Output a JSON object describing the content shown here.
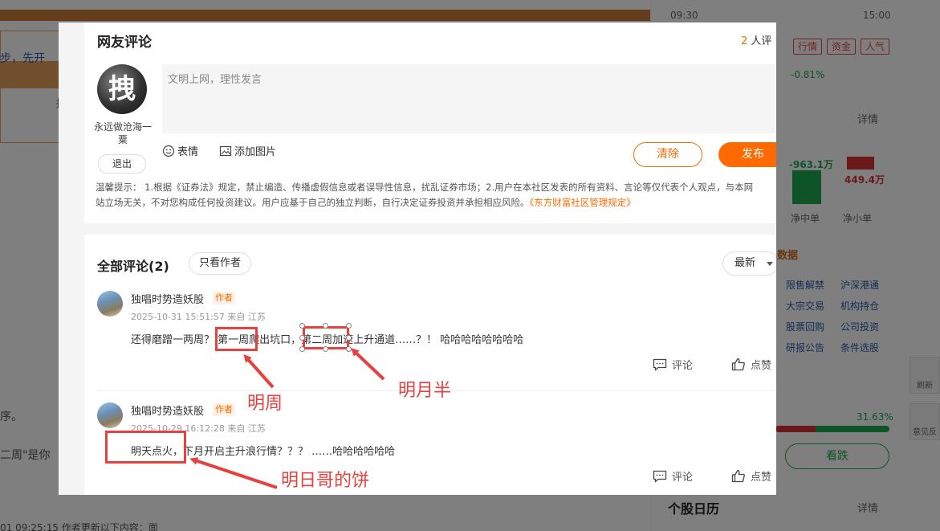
{
  "background": {
    "left_snippet_1": "步，先开",
    "left_snippet_2": "择",
    "left_snippet_3": "序。",
    "left_snippet_4": "二周\"是你",
    "left_footer": "01 09:25:15  作者更新以下内容：面",
    "time_start": "09:30",
    "time_end": "15:00",
    "tags": [
      "行情",
      "资金",
      "人气"
    ],
    "pct_change": "-0.81%",
    "detail_label": "详情",
    "fund_value_1": "-963.1万",
    "fund_value_2": "449.4万",
    "fund_label_1": "净中单",
    "fund_label_2": "净小单",
    "data_title": "数据",
    "links": [
      "限售解禁",
      "沪深港通",
      "大宗交易",
      "机构持仓",
      "股票回购",
      "公司投资",
      "研报公告",
      "条件选股"
    ],
    "ratio": "31.63%",
    "bear_button": "看跌",
    "tool_refresh": "刷新",
    "tool_feedback": "意见反",
    "calendar_title": "个股日历",
    "calendar_detail": "详情"
  },
  "modal": {
    "title": "网友评论",
    "count_num": "2",
    "count_text": "人评",
    "avatar_char": "拽",
    "username": "永远做沧海一粟",
    "logout": "退出",
    "editor_placeholder": "文明上网，理性发言",
    "tool_emoji": "表情",
    "tool_image": "添加图片",
    "btn_clear": "清除",
    "btn_post": "发布",
    "tips_line1": "温馨提示： 1.根据《证券法》规定，禁止编造、传播虚假信息或者误导性信息，扰乱证券市场；2.用户在本社区发表的所有资料、言论等仅代表个人观点，与本网",
    "tips_line2": "站立场无关，不对您构成任何投资建议。用户应基于自己的独立判断，自行决定证券投资并承担相应风险。",
    "tips_link": "《东方财富社区管理规定》",
    "all_comments": "全部评论(2)",
    "author_only": "只看作者",
    "sort": "最新"
  },
  "comments": [
    {
      "name": "独唱时势造妖股",
      "badge": "作者",
      "meta": "2025-10-31 15:51:57   来自 江苏",
      "text": "还得磨蹭一两周？ 第一周爬出坑口，第二周加速上升通道……？！ 哈哈哈哈哈哈哈哈",
      "reply": "评论",
      "like": "点赞"
    },
    {
      "name": "独唱时势造妖股",
      "badge": "作者",
      "meta": "2025-10-29 16:12:28   来自 江苏",
      "text": "明天点火，下月开启主升浪行情？？？ ……哈哈哈哈哈哈",
      "reply": "评论",
      "like": "点赞"
    }
  ],
  "annotations": {
    "label_1": "明周",
    "label_2": "明月半",
    "label_3": "明日哥的饼",
    "color": "#e8403e"
  },
  "colors": {
    "accent": "#ff6a00",
    "up": "#d93030",
    "down": "#1fa84f"
  }
}
